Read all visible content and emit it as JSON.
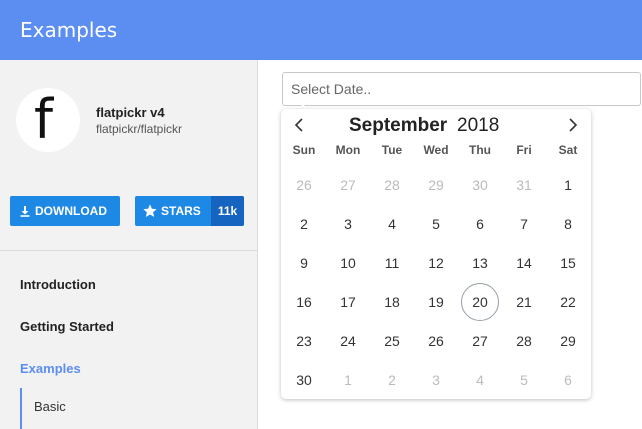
{
  "header": {
    "title": "Examples"
  },
  "sidebar": {
    "logo_letter": "f",
    "brand_name": "flatpickr v4",
    "brand_repo": "flatpickr/flatpickr",
    "download_label": "DOWNLOAD",
    "stars_label": "STARS",
    "stars_count": "11k",
    "nav": [
      {
        "label": "Introduction"
      },
      {
        "label": "Getting Started"
      },
      {
        "label": "Examples"
      }
    ],
    "sub_nav": [
      {
        "label": "Basic"
      }
    ]
  },
  "date_input": {
    "placeholder": "Select Date..",
    "value": ""
  },
  "calendar": {
    "month": "September",
    "year": "2018",
    "weekdays": [
      "Sun",
      "Mon",
      "Tue",
      "Wed",
      "Thu",
      "Fri",
      "Sat"
    ],
    "today": "20",
    "days": [
      {
        "d": "26",
        "m": true
      },
      {
        "d": "27",
        "m": true
      },
      {
        "d": "28",
        "m": true
      },
      {
        "d": "29",
        "m": true
      },
      {
        "d": "30",
        "m": true
      },
      {
        "d": "31",
        "m": true
      },
      {
        "d": "1",
        "m": false
      },
      {
        "d": "2",
        "m": false
      },
      {
        "d": "3",
        "m": false
      },
      {
        "d": "4",
        "m": false
      },
      {
        "d": "5",
        "m": false
      },
      {
        "d": "6",
        "m": false
      },
      {
        "d": "7",
        "m": false
      },
      {
        "d": "8",
        "m": false
      },
      {
        "d": "9",
        "m": false
      },
      {
        "d": "10",
        "m": false
      },
      {
        "d": "11",
        "m": false
      },
      {
        "d": "12",
        "m": false
      },
      {
        "d": "13",
        "m": false
      },
      {
        "d": "14",
        "m": false
      },
      {
        "d": "15",
        "m": false
      },
      {
        "d": "16",
        "m": false
      },
      {
        "d": "17",
        "m": false
      },
      {
        "d": "18",
        "m": false
      },
      {
        "d": "19",
        "m": false
      },
      {
        "d": "20",
        "m": false
      },
      {
        "d": "21",
        "m": false
      },
      {
        "d": "22",
        "m": false
      },
      {
        "d": "23",
        "m": false
      },
      {
        "d": "24",
        "m": false
      },
      {
        "d": "25",
        "m": false
      },
      {
        "d": "26",
        "m": false
      },
      {
        "d": "27",
        "m": false
      },
      {
        "d": "28",
        "m": false
      },
      {
        "d": "29",
        "m": false
      },
      {
        "d": "30",
        "m": false
      },
      {
        "d": "1",
        "m": true
      },
      {
        "d": "2",
        "m": true
      },
      {
        "d": "3",
        "m": true
      },
      {
        "d": "4",
        "m": true
      },
      {
        "d": "5",
        "m": true
      },
      {
        "d": "6",
        "m": true
      }
    ]
  },
  "icons": {
    "prev": "chevron-left-icon",
    "next": "chevron-right-icon",
    "download": "download-icon",
    "star": "star-icon"
  },
  "colors": {
    "header": "#5b8ef0",
    "button": "#1e88e5",
    "count_badge": "#1565c0",
    "active_nav": "#5b8ef0"
  }
}
